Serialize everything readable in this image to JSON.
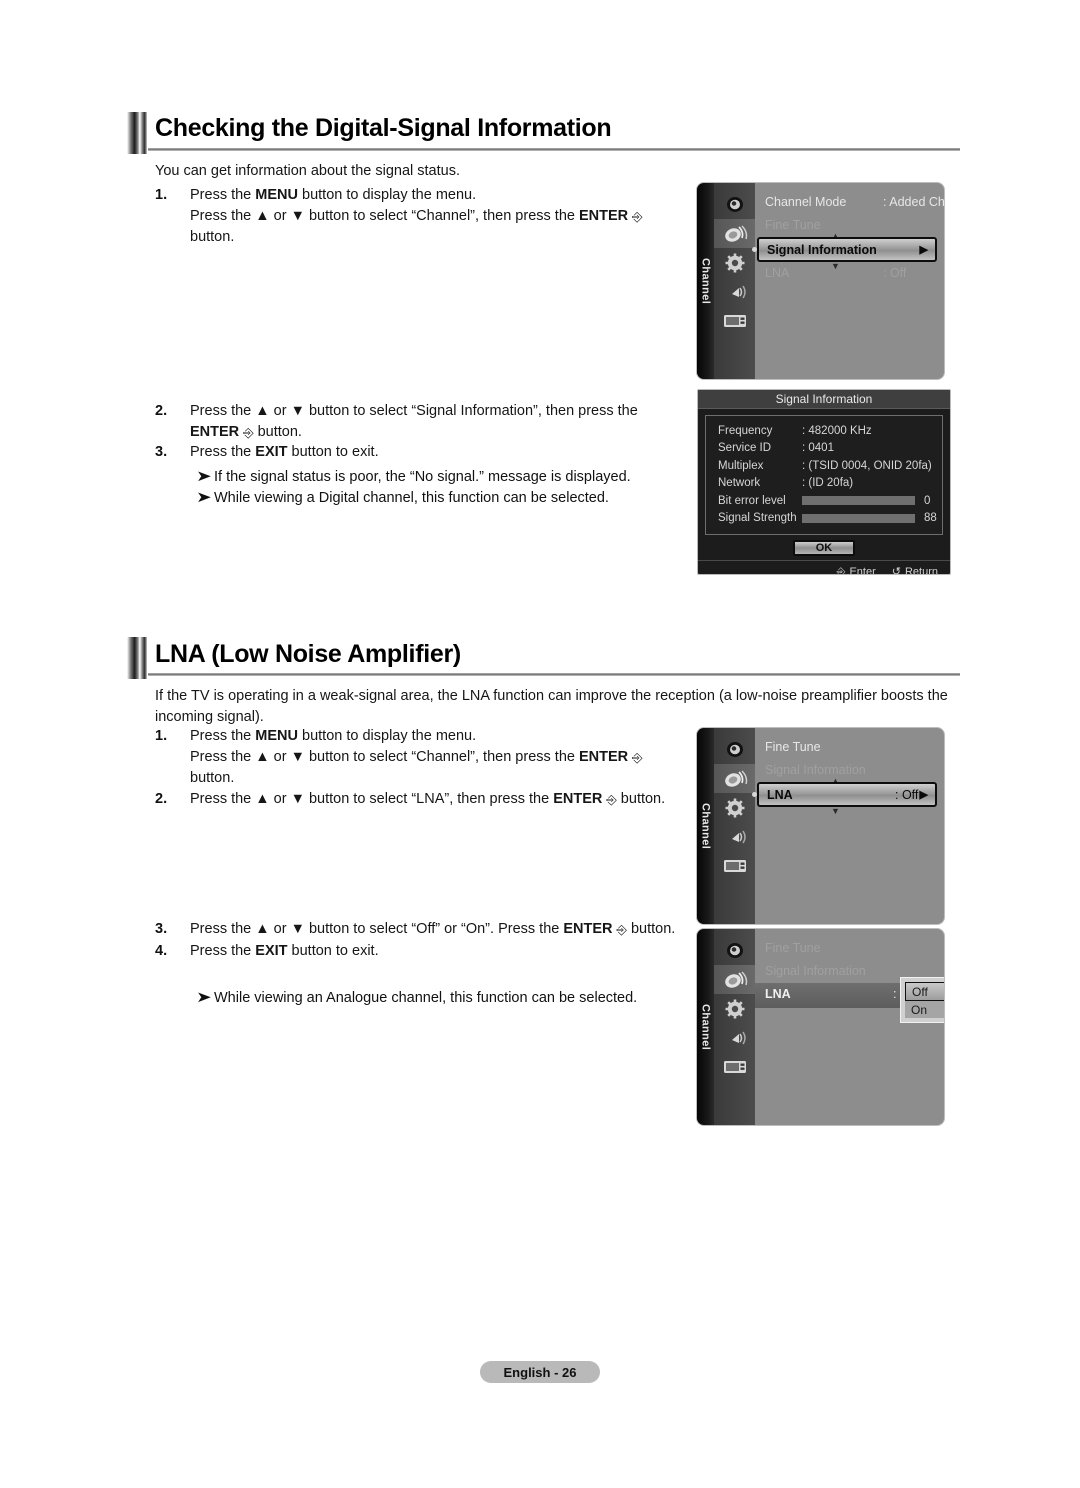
{
  "page": {
    "footer_label": "English - 26"
  },
  "sections": [
    {
      "id": "signal",
      "title": "Checking the Digital-Signal Information",
      "intro": "You can get information about the signal status.",
      "steps": [
        {
          "num": "1.",
          "line1_a": "Press the ",
          "line1_b": "MENU",
          "line1_c": " button to display the menu.",
          "line2_a": "Press the ▲ or ▼ button to select “Channel”, then press the ",
          "line2_b": "ENTER",
          "line2_c": " button.",
          "line3": "button."
        },
        {
          "num": "2.",
          "line1_a": "Press the ▲ or ▼ button to select “Signal Information”, then press the",
          "line2_b": "ENTER",
          "line2_c": " button."
        },
        {
          "num": "3.",
          "line1_a": "Press the ",
          "line1_b": "EXIT",
          "line1_c": " button to exit."
        }
      ],
      "notes": [
        "If the signal status is poor, the “No signal.” message is displayed.",
        "While viewing a Digital channel, this function can be selected."
      ]
    },
    {
      "id": "lna",
      "title": "LNA (Low Noise Amplifier)",
      "intro": "If the TV is operating in a weak-signal area, the LNA function can improve the reception (a low-noise preamplifier boosts the incoming signal).",
      "steps": [
        {
          "num": "1.",
          "line1_a": "Press the ",
          "line1_b": "MENU",
          "line1_c": " button to display the menu.",
          "line2_a": "Press the ▲ or ▼ button to select “Channel”, then press the ",
          "line2_b": "ENTER",
          "line2_c": " button.",
          "line3": "button."
        },
        {
          "num": "2.",
          "line1_a": "Press the ▲ or ▼ button to select “LNA”, then press the ",
          "line1_b": "ENTER",
          "line1_c": " button."
        },
        {
          "num": "3.",
          "line1_a": "Press the ▲ or ▼ button to select “Off” or “On”. Press the ",
          "line1_b": "ENTER",
          "line1_c": " button."
        },
        {
          "num": "4.",
          "line1_a": "Press the ",
          "line1_b": "EXIT",
          "line1_c": " button to exit."
        }
      ],
      "notes": [
        "While viewing an Analogue channel, this function can be selected."
      ]
    }
  ],
  "osd_menus": [
    {
      "id": "menu-signal-information",
      "rail_label": "Channel",
      "icons": [
        "picture-icon",
        "antenna-icon",
        "setup-gear-icon",
        "sound-icon",
        "input-icon"
      ],
      "active_icon_index": 1,
      "rows": [
        {
          "label": "Channel Mode",
          "value": ": Added Ch.",
          "state": "bright"
        },
        {
          "label": "Fine Tune",
          "value": "",
          "state": "dim"
        },
        {
          "label": "LNA",
          "value": ": Off",
          "state": "dim"
        }
      ],
      "selected": {
        "label": "Signal Information",
        "value": "",
        "arrow": "▶"
      }
    },
    {
      "id": "menu-lna",
      "rail_label": "Channel",
      "icons": [
        "picture-icon",
        "antenna-icon",
        "setup-gear-icon",
        "sound-icon",
        "input-icon"
      ],
      "active_icon_index": 1,
      "rows": [
        {
          "label": "Fine Tune",
          "value": "",
          "state": "bright"
        },
        {
          "label": "Signal Information",
          "value": "",
          "state": "dim"
        }
      ],
      "selected": {
        "label": "LNA",
        "value": ": Off",
        "arrow": "▶"
      }
    },
    {
      "id": "menu-lna-dropdown",
      "rail_label": "Channel",
      "icons": [
        "picture-icon",
        "antenna-icon",
        "setup-gear-icon",
        "sound-icon",
        "input-icon"
      ],
      "active_icon_index": 1,
      "rows": [
        {
          "label": "Fine Tune",
          "value": "",
          "state": "dim"
        },
        {
          "label": "Signal Information",
          "value": "",
          "state": "dim"
        }
      ],
      "selected": {
        "label": "LNA",
        "value": ":",
        "arrow": ""
      },
      "dropdown": {
        "options": [
          "Off",
          "On"
        ],
        "selected_index": 0
      }
    }
  ],
  "dialog": {
    "title": "Signal Information",
    "fields": [
      {
        "label": "Frequency",
        "value": ": 482000 KHz"
      },
      {
        "label": "Service ID",
        "value": ": 0401"
      },
      {
        "label": "Multiplex",
        "value": ": (TSID 0004, ONID 20fa)"
      },
      {
        "label": "Network",
        "value": ": (ID 20fa)"
      }
    ],
    "meters": [
      {
        "label": "Bit error level",
        "value": "0",
        "fill_percent": 100,
        "style": "dark"
      },
      {
        "label": "Signal Strength",
        "value": "88",
        "fill_percent": 88,
        "style": "light"
      }
    ],
    "ok_label": "OK",
    "foot": [
      {
        "key": "↵",
        "label": "Enter"
      },
      {
        "key": "↺",
        "label": "Return"
      }
    ]
  }
}
